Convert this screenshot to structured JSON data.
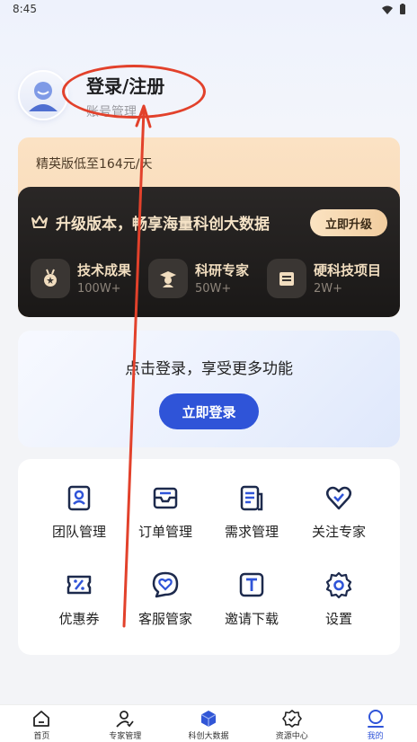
{
  "status_bar": {
    "time": "8:45"
  },
  "profile": {
    "title": "登录/注册",
    "subtitle": "账号管理"
  },
  "vip": {
    "price_text": "精英版低至164元/天",
    "slogan": "升级版本，畅享海量科创大数据",
    "upgrade_button": "立即升级",
    "stats": [
      {
        "label": "技术成果",
        "count": "100W+",
        "icon": "medal-icon"
      },
      {
        "label": "科研专家",
        "count": "50W+",
        "icon": "graduate-icon"
      },
      {
        "label": "硬科技项目",
        "count": "2W+",
        "icon": "folder-icon"
      }
    ]
  },
  "login_card": {
    "tip": "点击登录，享受更多功能",
    "button": "立即登录"
  },
  "menu": [
    {
      "label": "团队管理",
      "icon": "team-icon"
    },
    {
      "label": "订单管理",
      "icon": "order-icon"
    },
    {
      "label": "需求管理",
      "icon": "demand-icon"
    },
    {
      "label": "关注专家",
      "icon": "heart-icon"
    },
    {
      "label": "优惠券",
      "icon": "coupon-icon"
    },
    {
      "label": "客服管家",
      "icon": "service-icon"
    },
    {
      "label": "邀请下载",
      "icon": "invite-icon"
    },
    {
      "label": "设置",
      "icon": "settings-icon"
    }
  ],
  "tabbar": [
    {
      "label": "首页",
      "icon": "home-icon"
    },
    {
      "label": "专家管理",
      "icon": "expert-icon"
    },
    {
      "label": "科创大数据",
      "icon": "cube-icon"
    },
    {
      "label": "资源中心",
      "icon": "resource-icon"
    },
    {
      "label": "我的",
      "icon": "profile-icon",
      "active": true
    }
  ],
  "colors": {
    "accent": "#2f54d8",
    "annotation": "#e2412b",
    "vip_gold": "#f1ddbf"
  }
}
